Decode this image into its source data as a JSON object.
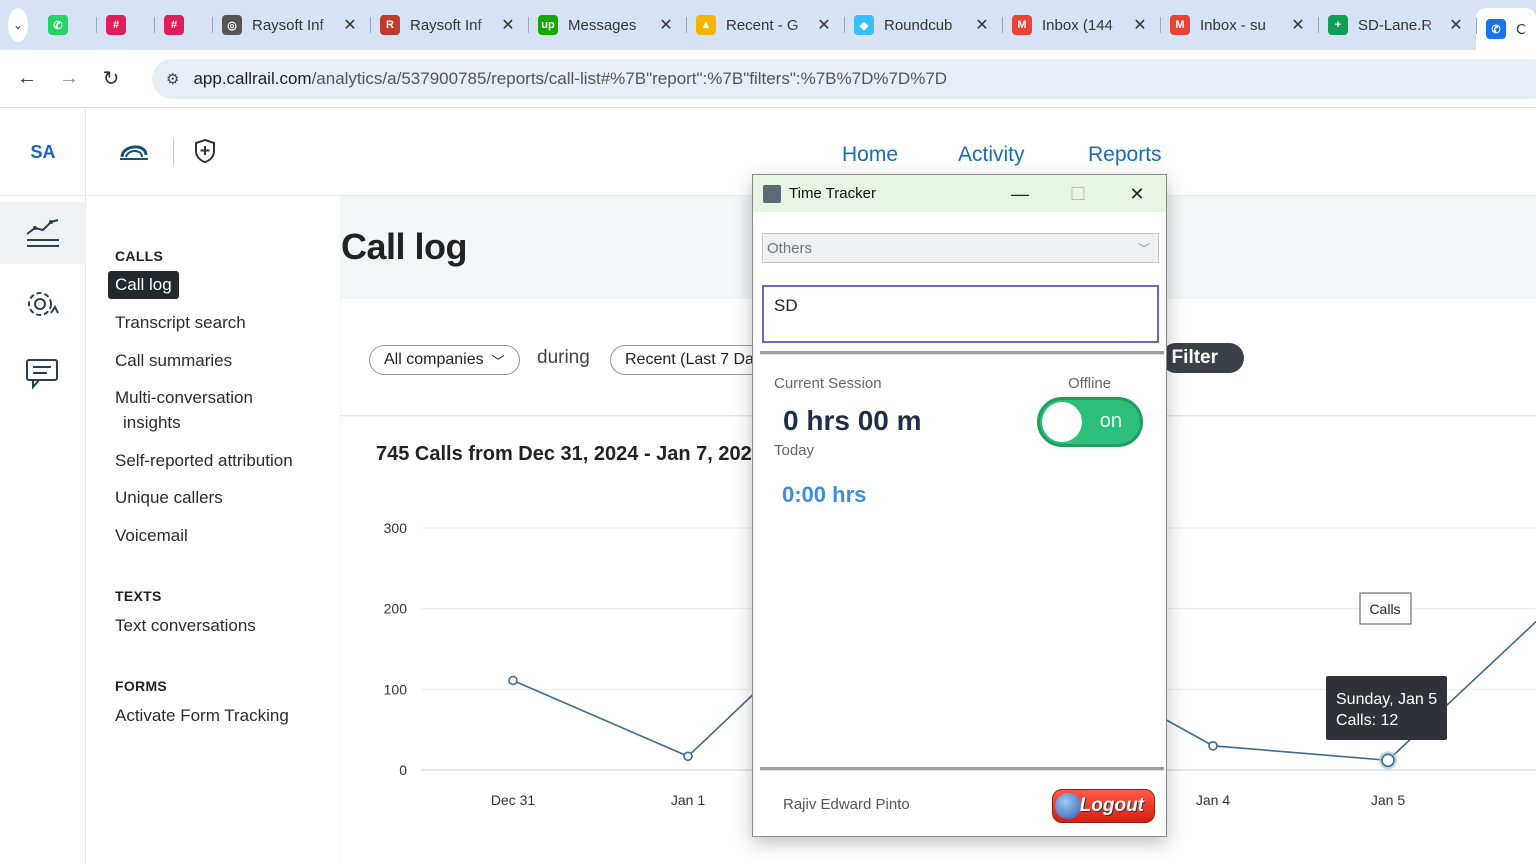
{
  "browser": {
    "tabs": [
      {
        "title": "",
        "favicon": "whatsapp-icon",
        "color": "#25d366",
        "glyph": "✆"
      },
      {
        "title": "",
        "favicon": "slack-icon",
        "color": "#e01e5a",
        "glyph": "#"
      },
      {
        "title": "",
        "favicon": "slack-icon",
        "color": "#e01e5a",
        "glyph": "#"
      },
      {
        "title": "Raysoft Inf",
        "favicon": "globe-icon",
        "color": "#555555",
        "glyph": "◎"
      },
      {
        "title": "Raysoft Inf",
        "favicon": "raysoft-icon",
        "color": "#c0392b",
        "glyph": "R"
      },
      {
        "title": "Messages",
        "favicon": "upwork-icon",
        "color": "#14a800",
        "glyph": "up"
      },
      {
        "title": "Recent - G",
        "favicon": "drive-icon",
        "color": "#f4b400",
        "glyph": "▲"
      },
      {
        "title": "Roundcub",
        "favicon": "roundcube-icon",
        "color": "#37beff",
        "glyph": "◆"
      },
      {
        "title": "Inbox (144",
        "favicon": "gmail-icon",
        "color": "#ea4335",
        "glyph": "M"
      },
      {
        "title": "Inbox - su",
        "favicon": "gmail-icon",
        "color": "#ea4335",
        "glyph": "M"
      },
      {
        "title": "SD-Lane.R",
        "favicon": "sheets-icon",
        "color": "#0f9d58",
        "glyph": "+"
      },
      {
        "title": "C",
        "favicon": "phone-icon",
        "color": "#1a73e8",
        "glyph": "✆",
        "active": true
      }
    ],
    "url_host": "app.callrail.com",
    "url_path": "/analytics/a/537900785/reports/call-list#%7B\"report\":%7B\"filters\":%7B%7D%7D%7D"
  },
  "app": {
    "account_initials": "SA",
    "topnav": [
      "Home",
      "Activity",
      "Reports"
    ],
    "page_title": "Call log",
    "sections": {
      "calls": {
        "heading": "CALLS",
        "items": [
          "Call log",
          "Transcript search",
          "Call summaries",
          "Multi-conversation",
          "insights",
          "Self-reported attribution",
          "Unique callers",
          "Voicemail"
        ]
      },
      "texts": {
        "heading": "TEXTS",
        "items": [
          "Text conversations"
        ]
      },
      "forms": {
        "heading": "FORMS",
        "items": [
          "Activate Form Tracking"
        ]
      }
    },
    "filters": {
      "company": "All companies",
      "during": "during",
      "range": "Recent (Last 7 Da",
      "add_filter": "l Filter"
    }
  },
  "chart_data": {
    "type": "line",
    "title": "745 Calls from Dec 31, 2024 - Jan 7, 2025",
    "categories": [
      "Dec 31",
      "Jan 1",
      "Jan 4",
      "Jan 5"
    ],
    "series": [
      {
        "name": "Calls",
        "x": [
          "Dec 31",
          "Jan 1",
          "Jan 4",
          "Jan 5"
        ],
        "values": [
          111,
          17,
          30,
          12
        ]
      }
    ],
    "yticks": [
      0,
      100,
      200,
      300
    ],
    "ylim": [
      0,
      300
    ],
    "tooltip": {
      "line1": "Sunday, Jan 5",
      "line2": "Calls: 12"
    },
    "legend": "Calls",
    "line_color": "#3f6a8f"
  },
  "time_tracker": {
    "window_title": "Time Tracker",
    "project": "Others",
    "task": "SD",
    "current_session_label": "Current Session",
    "current_session_value": "0 hrs 00 m",
    "status_label": "Offline",
    "toggle_label": "on",
    "today_label": "Today",
    "today_value": "0:00 hrs",
    "user_name": "Rajiv Edward Pinto",
    "logout_label": "Logout"
  }
}
